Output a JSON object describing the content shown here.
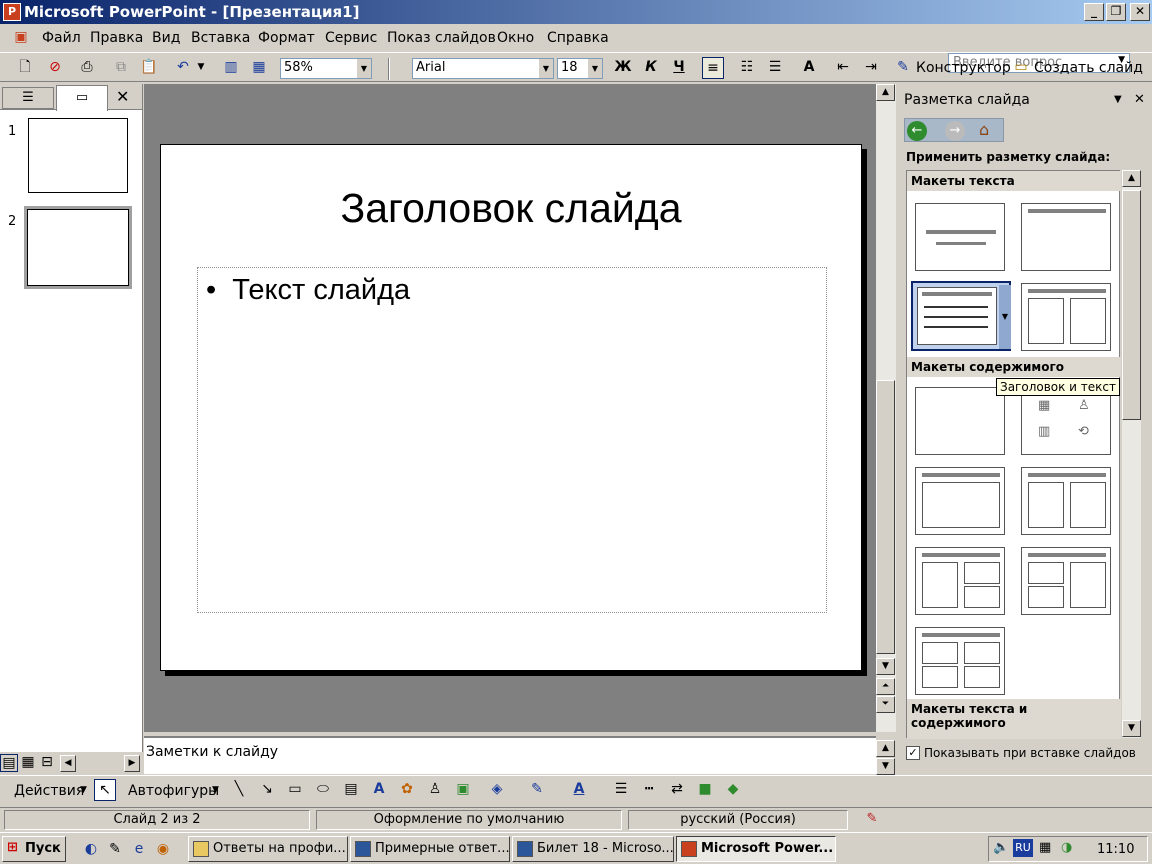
{
  "window": {
    "title": "Microsoft PowerPoint - [Презентация1]",
    "icon": "powerpoint-icon"
  },
  "menu": {
    "items": [
      "Файл",
      "Правка",
      "Вид",
      "Вставка",
      "Формат",
      "Сервис",
      "Показ слайдов",
      "Окно",
      "Справка"
    ],
    "help_placeholder": "Введите вопрос"
  },
  "toolbar": {
    "zoom": "58%",
    "font": "Arial",
    "size": "18",
    "bold": "Ж",
    "italic": "К",
    "underline": "Ч",
    "designer": "Конструктор",
    "new_slide": "Создать слайд"
  },
  "slides_pane": {
    "numbers": [
      "1",
      "2"
    ]
  },
  "slide": {
    "title": "Заголовок слайда",
    "bullet": "•",
    "text": "Текст слайда"
  },
  "notes": {
    "placeholder": "Заметки к слайду"
  },
  "task_pane": {
    "title": "Разметка слайда",
    "apply_label": "Применить разметку слайда:",
    "sections": [
      "Макеты текста",
      "Макеты содержимого",
      "Макеты текста и содержимого"
    ],
    "tooltip": "Заголовок и текст",
    "show_on_insert": "Показывать при вставке слайдов"
  },
  "drawing": {
    "actions": "Действия",
    "autoshapes": "Автофигуры"
  },
  "status": {
    "slide": "Слайд 2 из 2",
    "design": "Оформление по умолчанию",
    "language": "русский (Россия)"
  },
  "taskbar": {
    "start": "Пуск",
    "tasks": [
      "Ответы на профи...",
      "Примерные ответ...",
      "Билет 18 - Microso...",
      "Microsoft Power..."
    ],
    "lang": "RU",
    "clock": "11:10"
  }
}
